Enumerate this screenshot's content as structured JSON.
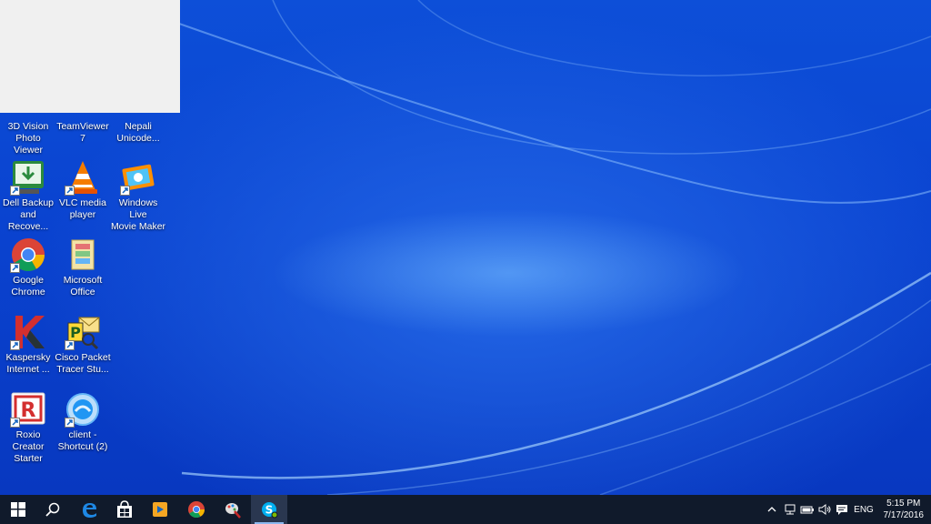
{
  "desktop": {
    "icons": [
      {
        "label": "3D Vision\nPhoto Viewer",
        "icon": "3d-vision-icon"
      },
      {
        "label": "TeamViewer\n7",
        "icon": "teamviewer-icon"
      },
      {
        "label": "Nepali\nUnicode...",
        "icon": "nepali-unicode-icon"
      },
      {
        "label": "Dell Backup\nand Recove...",
        "icon": "dell-backup-icon"
      },
      {
        "label": "VLC media\nplayer",
        "icon": "vlc-icon"
      },
      {
        "label": "Windows Live\nMovie Maker",
        "icon": "movie-maker-icon"
      },
      {
        "label": "Google\nChrome",
        "icon": "chrome-icon"
      },
      {
        "label": "Microsoft\nOffice",
        "icon": "office-folder-icon"
      },
      {
        "label": "Kaspersky\nInternet ...",
        "icon": "kaspersky-icon"
      },
      {
        "label": "Cisco Packet\nTracer Stu...",
        "icon": "packet-tracer-icon"
      },
      {
        "label": "Roxio Creator\nStarter",
        "icon": "roxio-icon"
      },
      {
        "label": "client -\nShortcut (2)",
        "icon": "client-icon"
      }
    ]
  },
  "taskbar": {
    "pinned": [
      {
        "name": "start",
        "icon": "windows-logo-icon"
      },
      {
        "name": "search",
        "icon": "search-icon"
      },
      {
        "name": "edge",
        "icon": "edge-icon"
      },
      {
        "name": "store",
        "icon": "store-icon"
      },
      {
        "name": "media-player",
        "icon": "media-player-icon"
      },
      {
        "name": "chrome",
        "icon": "chrome-icon"
      },
      {
        "name": "paint",
        "icon": "paint-icon"
      },
      {
        "name": "skype",
        "icon": "skype-icon"
      }
    ],
    "tray": {
      "language": "ENG",
      "time": "5:15 PM",
      "date": "7/17/2016"
    }
  }
}
